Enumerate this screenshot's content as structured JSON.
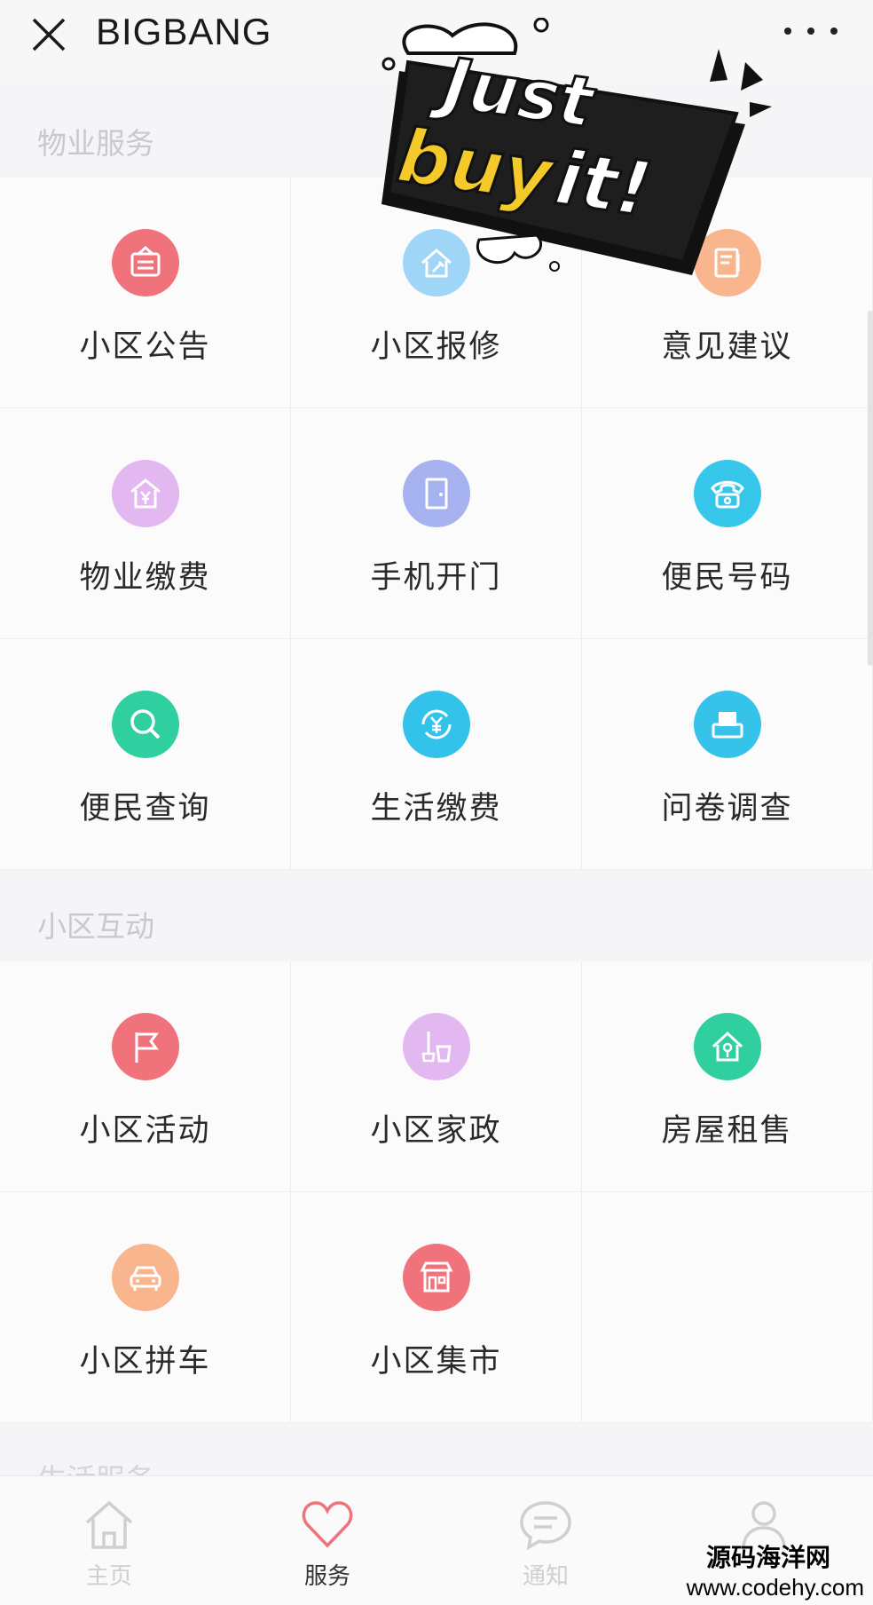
{
  "header": {
    "title": "BIGBANG"
  },
  "sticker": {
    "line1": "Just",
    "line2a": "buy",
    "line2b": "it!"
  },
  "sections": [
    {
      "title": "物业服务",
      "items": [
        {
          "label": "小区公告",
          "icon": "notice-board-icon",
          "color": "#f0727b"
        },
        {
          "label": "小区报修",
          "icon": "house-repair-icon",
          "color": "#9fd6f7"
        },
        {
          "label": "意见建议",
          "icon": "feedback-note-icon",
          "color": "#f9b58e"
        },
        {
          "label": "物业缴费",
          "icon": "house-yen-icon",
          "color": "#e3b7f0"
        },
        {
          "label": "手机开门",
          "icon": "door-icon",
          "color": "#a6b3f0"
        },
        {
          "label": "便民号码",
          "icon": "telephone-icon",
          "color": "#35c6ea"
        },
        {
          "label": "便民查询",
          "icon": "magnifier-icon",
          "color": "#2fcf9f"
        },
        {
          "label": "生活缴费",
          "icon": "yen-cycle-icon",
          "color": "#33c3ea"
        },
        {
          "label": "问卷调查",
          "icon": "survey-icon",
          "color": "#36c3ea"
        }
      ]
    },
    {
      "title": "小区互动",
      "items": [
        {
          "label": "小区活动",
          "icon": "flag-icon",
          "color": "#f0727b"
        },
        {
          "label": "小区家政",
          "icon": "mop-bucket-icon",
          "color": "#e3b7f0"
        },
        {
          "label": "房屋租售",
          "icon": "house-key-icon",
          "color": "#2fcf9f"
        },
        {
          "label": "小区拼车",
          "icon": "car-icon",
          "color": "#f9b58e"
        },
        {
          "label": "小区集市",
          "icon": "shop-icon",
          "color": "#f0727b"
        }
      ]
    }
  ],
  "partial_section": "生活服务",
  "tabs": [
    {
      "label": "主页",
      "icon": "home-icon",
      "active": false
    },
    {
      "label": "服务",
      "icon": "heart-icon",
      "active": true
    },
    {
      "label": "通知",
      "icon": "chat-bubble-icon",
      "active": false
    },
    {
      "label": "",
      "icon": "user-icon",
      "active": false
    }
  ],
  "watermark": {
    "line1": "源码海洋网",
    "line2": "www.codehy.com"
  }
}
